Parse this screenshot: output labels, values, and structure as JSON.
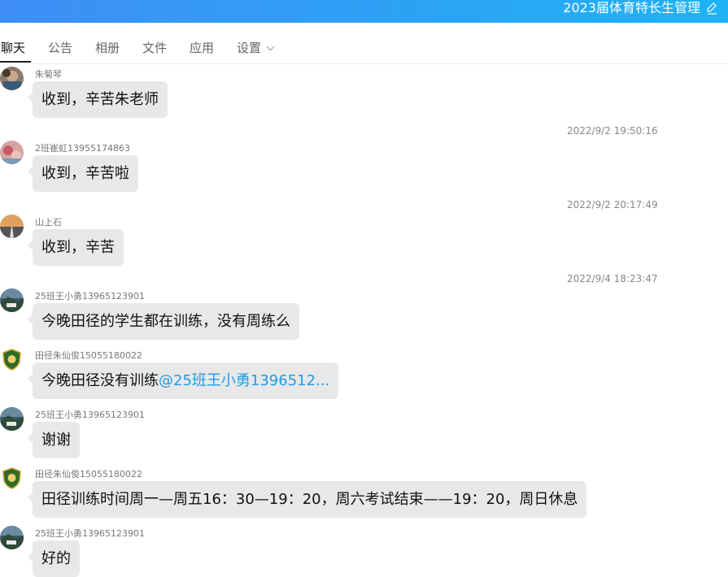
{
  "header": {
    "group_title": "2023届体育特长生管理",
    "edit_icon": "edit-icon",
    "colors": {
      "gradient_start": "#3f8ef5",
      "gradient_end": "#1fb2f5"
    }
  },
  "tabs": [
    {
      "label": "聊天",
      "active": true
    },
    {
      "label": "公告"
    },
    {
      "label": "相册"
    },
    {
      "label": "文件"
    },
    {
      "label": "应用"
    },
    {
      "label": "设置",
      "has_dropdown": true
    }
  ],
  "messages": [
    {
      "sender": "朱菊琴",
      "text": "收到，辛苦朱老师"
    },
    {
      "timestamp": "2022/9/2 19:50:16",
      "sender": "2班崔虹13955174863",
      "text": "收到，辛苦啦"
    },
    {
      "timestamp": "2022/9/2 20:17:49",
      "sender": "山上石",
      "text": "收到，辛苦"
    },
    {
      "timestamp": "2022/9/4 18:23:47",
      "sender": "25班王小勇13965123901",
      "text": "今晚田径的学生都在训练，没有周练么"
    },
    {
      "sender": "田径朱仙俊15055180022",
      "text": "今晚田径没有训练",
      "mention": "@25班王小勇1396512..."
    },
    {
      "sender": "25班王小勇13965123901",
      "text": "谢谢"
    },
    {
      "sender": "田径朱仙俊15055180022",
      "text": "田径训练时间周一—周五16：30—19：20，周六考试结束——19：20，周日休息"
    },
    {
      "sender": "25班王小勇13965123901",
      "text": "好的"
    }
  ]
}
